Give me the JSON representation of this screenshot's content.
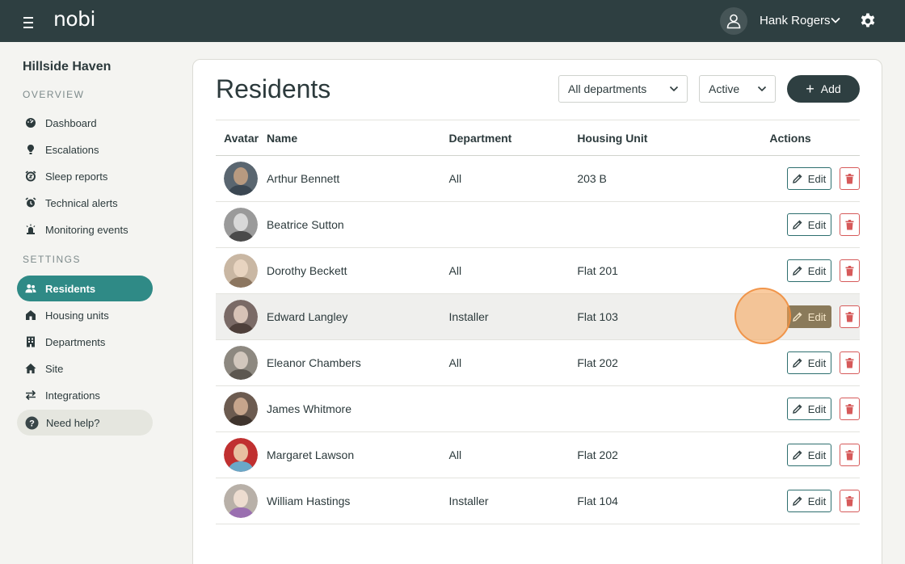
{
  "header": {
    "logo": "nobi",
    "user_name": "Hank Rogers"
  },
  "sidebar": {
    "site_name": "Hillside Haven",
    "overview_label": "OVERVIEW",
    "settings_label": "SETTINGS",
    "overview_items": [
      {
        "label": "Dashboard",
        "icon": "dashboard-icon"
      },
      {
        "label": "Escalations",
        "icon": "escalations-icon"
      },
      {
        "label": "Sleep reports",
        "icon": "sleep-reports-icon"
      },
      {
        "label": "Technical alerts",
        "icon": "technical-alerts-icon"
      },
      {
        "label": "Monitoring events",
        "icon": "monitoring-events-icon"
      }
    ],
    "settings_items": [
      {
        "label": "Residents",
        "icon": "residents-icon",
        "active": true
      },
      {
        "label": "Housing units",
        "icon": "housing-units-icon"
      },
      {
        "label": "Departments",
        "icon": "departments-icon"
      },
      {
        "label": "Site",
        "icon": "site-icon"
      },
      {
        "label": "Integrations",
        "icon": "integrations-icon"
      }
    ],
    "help_label": "Need help?"
  },
  "main": {
    "title": "Residents",
    "department_filter": "All departments",
    "status_filter": "Active",
    "add_label": "Add",
    "columns": [
      "Avatar",
      "Name",
      "Department",
      "Housing Unit",
      "Actions"
    ],
    "edit_label": "Edit",
    "rows": [
      {
        "name": "Arthur Bennett",
        "department": "All",
        "housing": "203 B"
      },
      {
        "name": "Beatrice Sutton",
        "department": "",
        "housing": ""
      },
      {
        "name": "Dorothy Beckett",
        "department": "All",
        "housing": "Flat 201"
      },
      {
        "name": "Edward Langley",
        "department": "Installer",
        "housing": "Flat 103"
      },
      {
        "name": "Eleanor Chambers",
        "department": "All",
        "housing": "Flat 202"
      },
      {
        "name": "James Whitmore",
        "department": "",
        "housing": ""
      },
      {
        "name": "Margaret Lawson",
        "department": "All",
        "housing": "Flat 202"
      },
      {
        "name": "William Hastings",
        "department": "Installer",
        "housing": "Flat 104"
      }
    ]
  },
  "colors": {
    "topbar": "#2e3f41",
    "accent": "#2f8a86",
    "delete": "#d65a5a"
  }
}
